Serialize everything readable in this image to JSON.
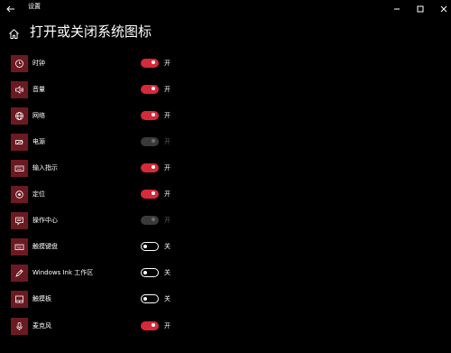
{
  "window": {
    "app_title": "设置"
  },
  "header": {
    "title": "打开或关闭系统图标"
  },
  "items": [
    {
      "label": "时钟",
      "state": "on",
      "state_label": "开",
      "icon": "clock-icon"
    },
    {
      "label": "音量",
      "state": "on",
      "state_label": "开",
      "icon": "volume-icon"
    },
    {
      "label": "网络",
      "state": "on",
      "state_label": "开",
      "icon": "globe-icon"
    },
    {
      "label": "电源",
      "state": "disabled",
      "state_label": "开",
      "icon": "battery-icon"
    },
    {
      "label": "输入指示",
      "state": "on",
      "state_label": "开",
      "icon": "keyboard-icon"
    },
    {
      "label": "定位",
      "state": "on",
      "state_label": "开",
      "icon": "location-icon"
    },
    {
      "label": "操作中心",
      "state": "disabled",
      "state_label": "开",
      "icon": "action-center-icon"
    },
    {
      "label": "触摸键盘",
      "state": "off",
      "state_label": "关",
      "icon": "touch-keyboard-icon"
    },
    {
      "label": "Windows Ink 工作区",
      "state": "off",
      "state_label": "关",
      "icon": "pen-icon"
    },
    {
      "label": "触摸板",
      "state": "off",
      "state_label": "关",
      "icon": "touchpad-icon"
    },
    {
      "label": "麦克风",
      "state": "on",
      "state_label": "开",
      "icon": "microphone-icon"
    }
  ],
  "colors": {
    "accent": "#d42a39",
    "icon_tile": "#6b1a22",
    "background": "#000000"
  }
}
